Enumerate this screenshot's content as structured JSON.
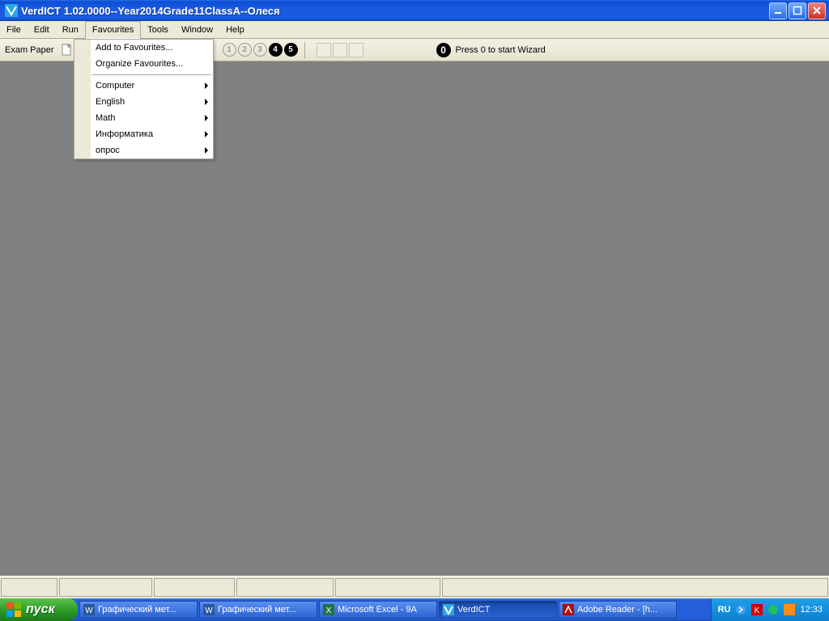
{
  "titlebar": {
    "title": "VerdICT 1.02.0000--Year2014Grade11ClassA--Олеся"
  },
  "menubar": {
    "items": [
      "File",
      "Edit",
      "Run",
      "Favourites",
      "Tools",
      "Window",
      "Help"
    ],
    "open_index": 3
  },
  "toolbar": {
    "exam_label": "Exam Paper",
    "numbers": [
      "1",
      "2",
      "3",
      "4",
      "5"
    ],
    "solid_from_index": 3,
    "wizard_digit": "0",
    "wizard_text": "Press 0 to start Wizard"
  },
  "dropdown": {
    "top_items": [
      "Add to Favourites...",
      "Organize Favourites..."
    ],
    "sub_items": [
      "Computer",
      "English",
      "Math",
      "Информатика",
      "опрос"
    ]
  },
  "taskbar": {
    "start": "пуск",
    "buttons": [
      {
        "label": "Графический мет...",
        "kind": "word"
      },
      {
        "label": "Графический мет...",
        "kind": "word"
      },
      {
        "label": "Microsoft Excel - 9A",
        "kind": "excel"
      },
      {
        "label": "VerdICT",
        "kind": "verdict",
        "active": true
      },
      {
        "label": "Adobe Reader - [h...",
        "kind": "adobe"
      }
    ],
    "lang": "RU",
    "clock": "12:33"
  }
}
